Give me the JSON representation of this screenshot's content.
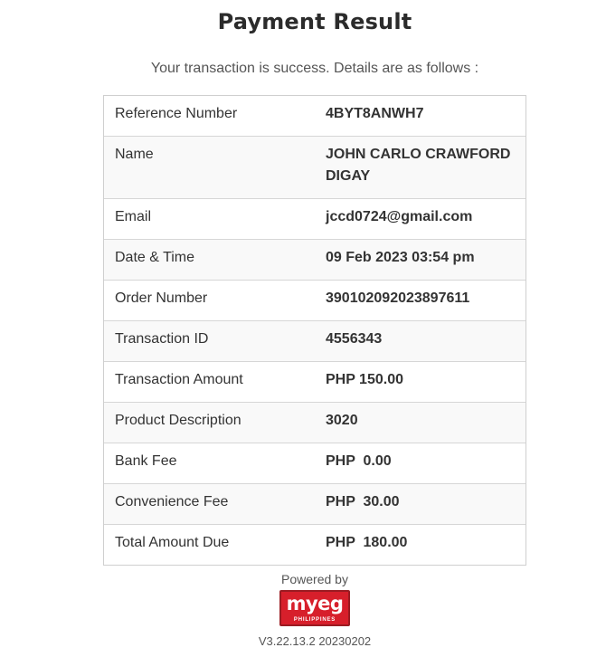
{
  "page": {
    "title": "Payment Result",
    "subtitle": "Your transaction is success. Details are as follows :"
  },
  "details": [
    {
      "label": "Reference Number",
      "value": "4BYT8ANWH7"
    },
    {
      "label": "Name",
      "value": "JOHN CARLO CRAWFORD\nDIGAY"
    },
    {
      "label": "Email",
      "value": "jccd0724@gmail.com"
    },
    {
      "label": "Date & Time",
      "value": "09 Feb 2023 03:54 pm"
    },
    {
      "label": "Order Number",
      "value": "390102092023897611"
    },
    {
      "label": "Transaction ID",
      "value": "4556343"
    },
    {
      "label": "Transaction Amount",
      "value": "PHP 150.00"
    },
    {
      "label": "Product Description",
      "value": "3020"
    },
    {
      "label": "Bank Fee",
      "value": "PHP  0.00"
    },
    {
      "label": "Convenience Fee",
      "value": "PHP  30.00"
    },
    {
      "label": "Total Amount Due",
      "value": "PHP  180.00"
    }
  ],
  "footer": {
    "powered_by": "Powered by",
    "logo_text": "myeg",
    "logo_subtext": "PHILIPPINES",
    "version": "V3.22.13.2 20230202"
  },
  "colors": {
    "brand": "#d71f2b"
  }
}
